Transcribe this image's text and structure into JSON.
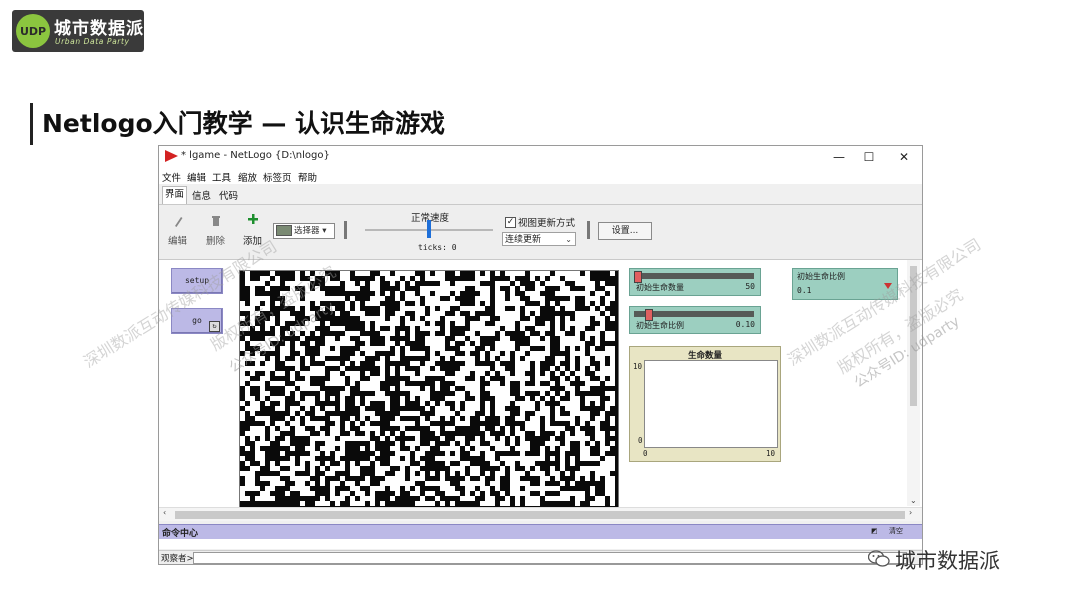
{
  "brand": {
    "logo_mark": "UDP",
    "logo_title": "城市数据派",
    "logo_subtitle": "Urban Data Party",
    "footer_name": "城市数据派"
  },
  "slide": {
    "title": "Netlogo入门教学 — 认识生命游戏"
  },
  "window": {
    "title": "* lgame - NetLogo {D:\\nlogo}",
    "minimize": "—",
    "maximize": "☐",
    "close": "✕",
    "menu": [
      "文件",
      "编辑",
      "工具",
      "缩放",
      "标签页",
      "帮助"
    ],
    "tabs": [
      "界面",
      "信息",
      "代码"
    ],
    "active_tab": "界面"
  },
  "toolbar": {
    "edit_label": "编辑",
    "delete_label": "删除",
    "add_label": "添加",
    "chooser_label": "选择器",
    "speed_title": "正常速度",
    "speed_fraction": 0.5,
    "ticks_text": "ticks: 0",
    "view_update_label": "视图更新方式",
    "view_update_checked": true,
    "update_mode": "连续更新",
    "settings_label": "设置..."
  },
  "interface": {
    "setup_button": "setup",
    "go_button": "go",
    "sliders": [
      {
        "name": "初始生命数量",
        "value": "50",
        "fraction": 0.0
      },
      {
        "name": "初始生命比例",
        "value": "0.10",
        "fraction": 0.1
      }
    ],
    "input": {
      "name": "初始生命比例",
      "value": "0.1"
    },
    "plot": {
      "title": "生命数量",
      "y_max": "10",
      "y_min": "0",
      "x_min": "0",
      "x_max": "10"
    }
  },
  "command_center": {
    "label": "命令中心",
    "clear_label": "清空",
    "observer_label": "观察者>"
  },
  "watermark": {
    "line1": "深圳数派互动传媒科技有限公司",
    "line2": "版权所有，盗版必究",
    "line3": "公众号ID: udparty"
  },
  "colors": {
    "button_widget": "#bcb9e6",
    "slider_widget": "#9ccfc0",
    "plot_widget": "#e8e5c4",
    "logo_green": "#8bc53f"
  }
}
